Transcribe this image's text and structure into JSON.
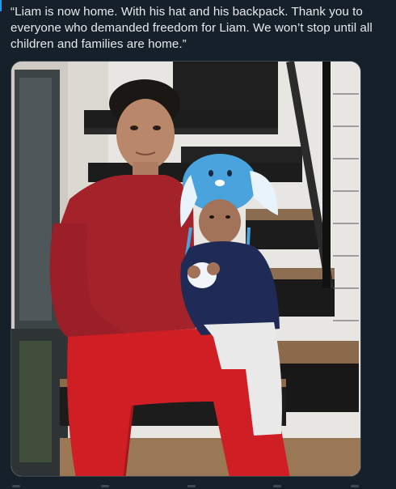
{
  "tweet": {
    "text": "“Liam is now home. With his hat and his backpack. Thank you to everyone who demanded freedom for Liam. We won’t stop until all children and families are home.”"
  },
  "colors": {
    "background": "#15202b",
    "text": "#e7e9ea",
    "media_border": "#38444d",
    "accent": "#1d9bf0"
  }
}
